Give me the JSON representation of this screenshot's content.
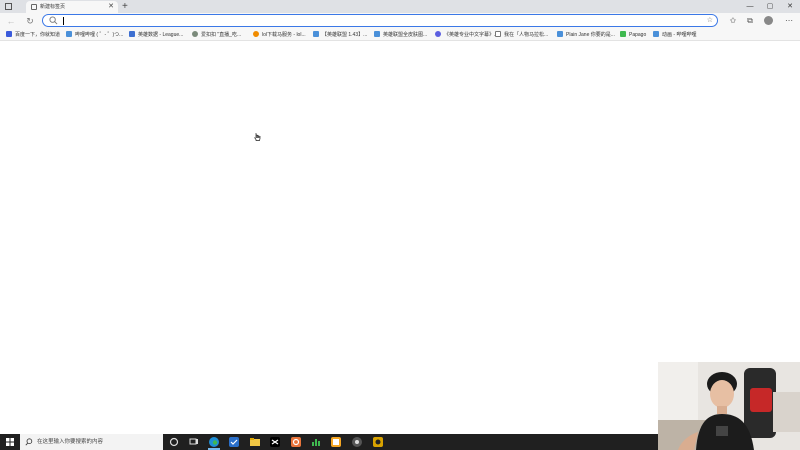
{
  "browser": {
    "tab": {
      "title": "新建标签页",
      "close_label": "✕"
    },
    "new_tab_label": "+",
    "window_controls": {
      "minimize": "—",
      "maximize": "▢",
      "close": "✕"
    },
    "address_bar": {
      "value": "",
      "placeholder": ""
    }
  },
  "bookmarks": [
    {
      "label": "百度一下，你就知道",
      "icon_color": "#3b5bdb"
    },
    {
      "label": "哔哩哔哩 ( ゜- ゜)つ...",
      "icon_color": "#4a90d9"
    },
    {
      "label": "英雄数据 - League...",
      "icon_color": "#3d6fd1"
    },
    {
      "label": "爱扣扣 \"直播_吃...",
      "icon_color": "#7a8a7a"
    },
    {
      "label": "lol下载马服务 - lol...",
      "icon_color": "#f08c00"
    },
    {
      "label": "【英雄联盟 1.43】...",
      "icon_color": "#4a90d9"
    },
    {
      "label": "英雄联盟全皮肤图...",
      "icon_color": "#4a90d9"
    },
    {
      "label": "《英雄专业中文字幕》...",
      "icon_color": "#5c5fe0"
    },
    {
      "label": "我在「人物马拉松...",
      "icon_color": "#777777"
    },
    {
      "label": "Plain Jane 你要的是...",
      "icon_color": "#4a90d9"
    },
    {
      "label": "Papago",
      "icon_color": "#3fb950"
    },
    {
      "label": "动画 - 哔哩哔哩",
      "icon_color": "#4a90d9"
    }
  ],
  "taskbar": {
    "search_placeholder": "在这里输入你要搜索的内容",
    "apps": [
      {
        "name": "cortana-icon",
        "color": "#cccccc"
      },
      {
        "name": "task-view-icon",
        "color": "#cccccc"
      },
      {
        "name": "edge-icon",
        "color": "#1f8fd6"
      },
      {
        "name": "steam-like-icon",
        "color": "#2a6fc9"
      },
      {
        "name": "file-explorer-icon",
        "color": "#f2c744"
      },
      {
        "name": "capcut-icon",
        "color": "#ffffff"
      },
      {
        "name": "g-app-icon",
        "color": "#e8743b"
      },
      {
        "name": "chart-app-icon",
        "color": "#3fb950"
      },
      {
        "name": "notes-app-icon",
        "color": "#f5a623"
      },
      {
        "name": "obs-icon",
        "color": "#555555"
      },
      {
        "name": "orange-app-icon",
        "color": "#d9a300"
      }
    ]
  }
}
